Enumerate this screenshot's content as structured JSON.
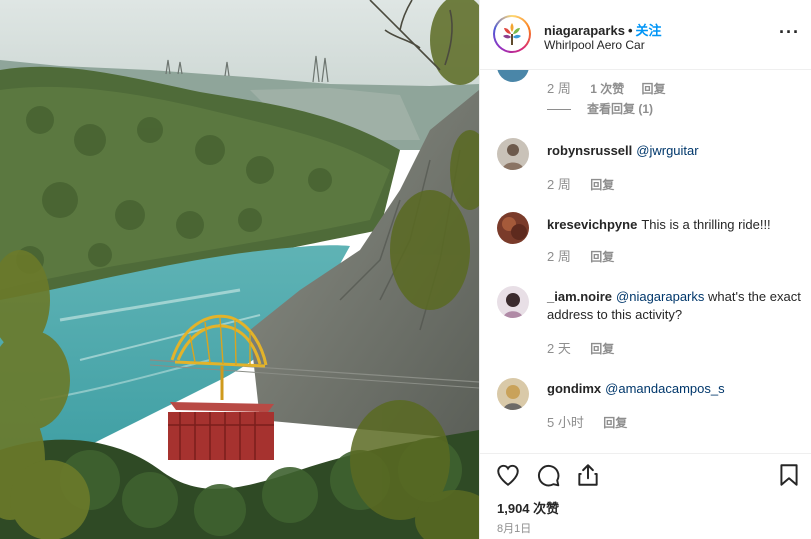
{
  "header": {
    "username": "niagaraparks",
    "dot": "•",
    "follow_label": "关注",
    "location": "Whirlpool Aero Car",
    "more_icon": "more-horizontal-icon",
    "more_glyph": "···"
  },
  "comments": [
    {
      "user": "",
      "text": "",
      "time": "2 周",
      "likes": "1 次赞",
      "reply_label": "回复",
      "view_replies": "查看回复 (1)"
    },
    {
      "user": "robynsrussell",
      "mention": "@jwrguitar",
      "text": "",
      "time": "2 周",
      "reply_label": "回复"
    },
    {
      "user": "kresevichpyne",
      "mention": "",
      "text": "This is a thrilling ride!!!",
      "time": "2 周",
      "reply_label": "回复"
    },
    {
      "user": "_iam.noire",
      "mention": "@niagaraparks",
      "text": "what's the exact address to this activity?",
      "time": "2 天",
      "reply_label": "回复"
    },
    {
      "user": "gondimx",
      "mention": "@amandacampos_s",
      "text": "",
      "time": "5 小时",
      "reply_label": "回复"
    }
  ],
  "actions": {
    "icons": [
      "heart-icon",
      "comment-icon",
      "share-icon",
      "bookmark-icon"
    ],
    "likes_count": "1,904 次赞",
    "date": "8月1日"
  },
  "colors": {
    "accent": "#0095f6",
    "mention": "#00376b",
    "secondary_text": "#8e8e8e",
    "border": "#efefef"
  }
}
